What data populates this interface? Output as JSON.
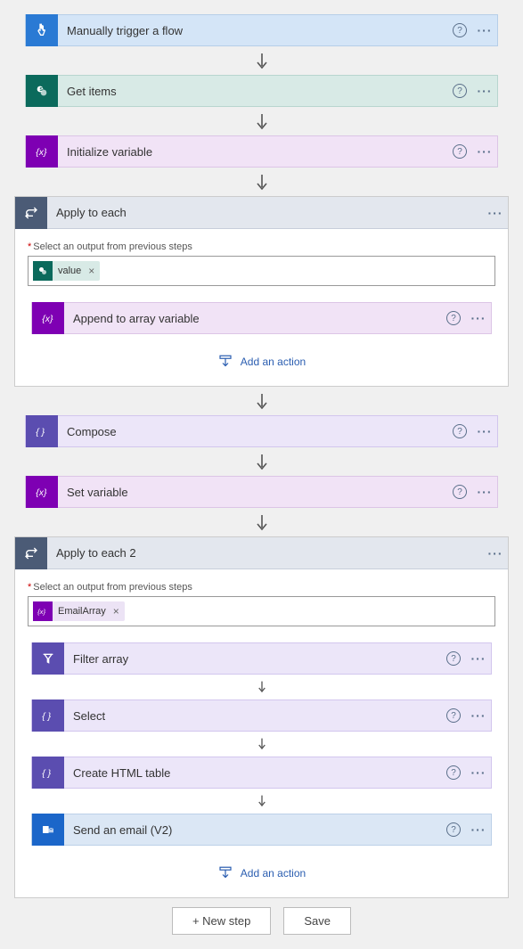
{
  "steps": {
    "trigger": {
      "title": "Manually trigger a flow"
    },
    "getItems": {
      "title": "Get items"
    },
    "initVar": {
      "title": "Initialize variable"
    },
    "compose": {
      "title": "Compose"
    },
    "setVar": {
      "title": "Set variable"
    },
    "appendArray": {
      "title": "Append to array variable"
    },
    "filterArray": {
      "title": "Filter array"
    },
    "select": {
      "title": "Select"
    },
    "createHtmlTable": {
      "title": "Create HTML table"
    },
    "sendEmail": {
      "title": "Send an email (V2)"
    }
  },
  "foreach1": {
    "title": "Apply to each",
    "fieldLabel": "Select an output from previous steps",
    "token": {
      "label": "value"
    }
  },
  "foreach2": {
    "title": "Apply to each 2",
    "fieldLabel": "Select an output from previous steps",
    "token": {
      "label": "EmailArray"
    }
  },
  "addAction": "Add an action",
  "footer": {
    "newStep": "+ New step",
    "save": "Save"
  },
  "tokenClose": "×"
}
